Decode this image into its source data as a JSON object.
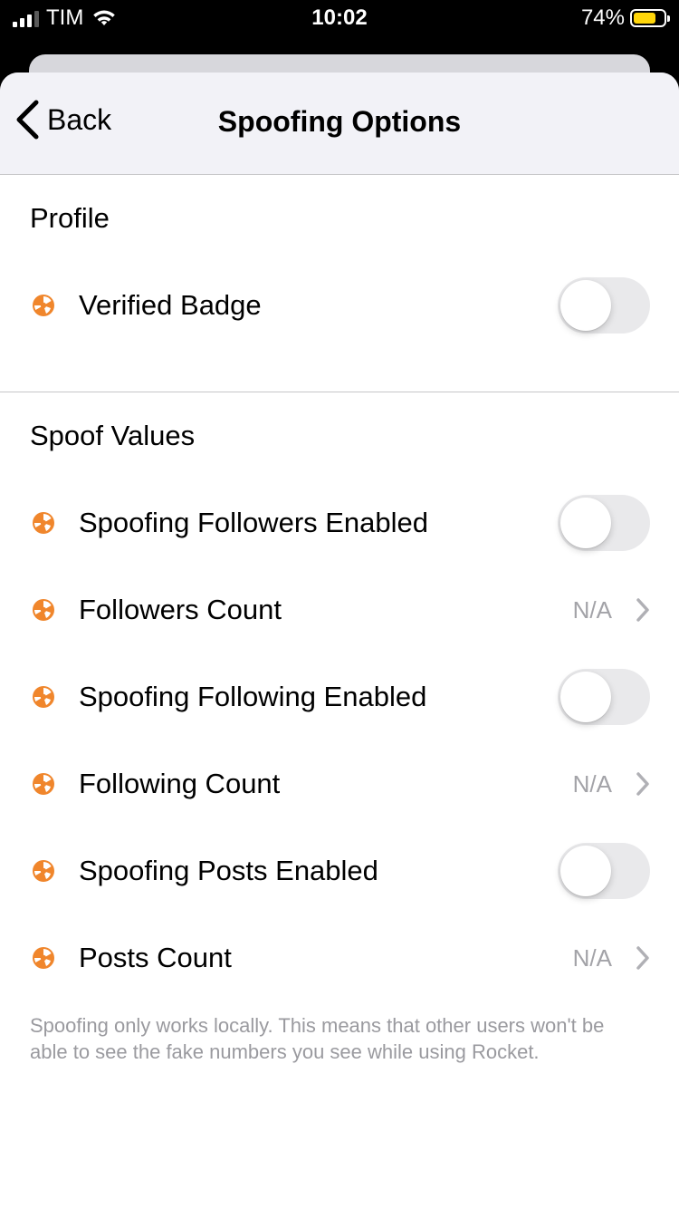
{
  "status_bar": {
    "carrier": "TIM",
    "time": "10:02",
    "battery_percent": "74%",
    "battery_level": 0.74,
    "battery_color": "#ffd60a"
  },
  "nav": {
    "back_label": "Back",
    "title": "Spoofing Options"
  },
  "sections": {
    "profile": {
      "header": "Profile",
      "verified_badge": {
        "label": "Verified Badge",
        "enabled": false
      }
    },
    "spoof_values": {
      "header": "Spoof Values",
      "followers_enabled": {
        "label": "Spoofing Followers Enabled",
        "enabled": false
      },
      "followers_count": {
        "label": "Followers Count",
        "value": "N/A"
      },
      "following_enabled": {
        "label": "Spoofing Following Enabled",
        "enabled": false
      },
      "following_count": {
        "label": "Following Count",
        "value": "N/A"
      },
      "posts_enabled": {
        "label": "Spoofing Posts Enabled",
        "enabled": false
      },
      "posts_count": {
        "label": "Posts Count",
        "value": "N/A"
      }
    }
  },
  "footer_note": "Spoofing only works locally. This means that other users won't be able to see the fake numbers you see while using Rocket.",
  "colors": {
    "accent_icon": "#f0862c",
    "toggle_off": "#e9e9eb"
  }
}
